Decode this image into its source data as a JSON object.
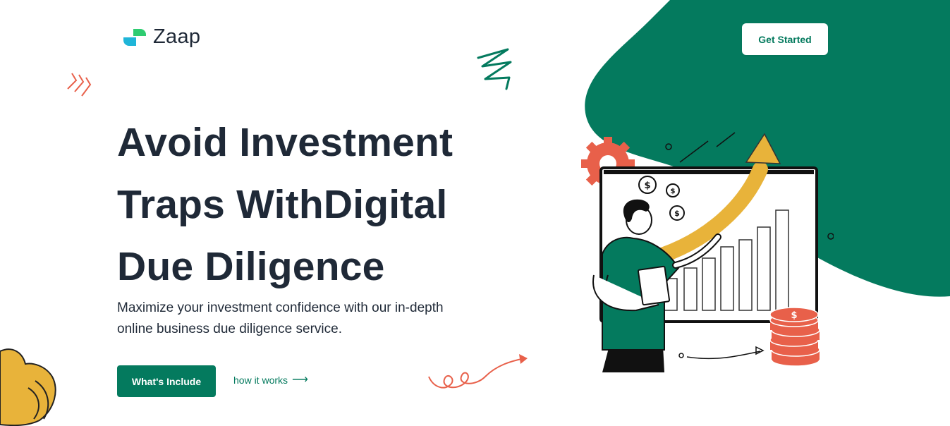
{
  "brand": {
    "name": "Zaap"
  },
  "header": {
    "cta_label": "Get Started"
  },
  "hero": {
    "title_lines": [
      "Avoid Investment",
      "Traps WithDigital",
      "Due Diligence"
    ],
    "subtitle_lines": [
      "Maximize your investment confidence with our in-depth",
      "online business due diligence service."
    ],
    "primary_cta": "What's Include",
    "secondary_link": "how it works",
    "secondary_arrow": "⟶"
  },
  "colors": {
    "brand_green": "#047a5e",
    "accent_orange": "#e8604a",
    "accent_yellow": "#e8b33a",
    "text_dark": "#1f2937"
  }
}
